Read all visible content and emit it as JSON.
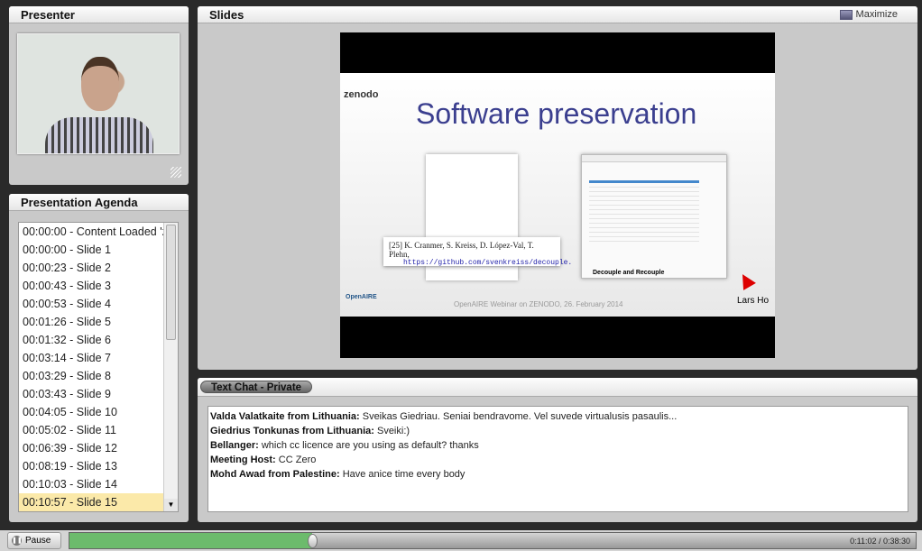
{
  "presenter": {
    "title": "Presenter"
  },
  "agenda": {
    "title": "Presentation Agenda",
    "selected_index": 15,
    "items": [
      "00:00:00 - Content Loaded 'z",
      "00:00:00 - Slide 1",
      "00:00:23 - Slide 2",
      "00:00:43 - Slide 3",
      "00:00:53 - Slide 4",
      "00:01:26 - Slide 5",
      "00:01:32 - Slide 6",
      "00:03:14 - Slide 7",
      "00:03:29 - Slide 8",
      "00:03:43 - Slide 9",
      "00:04:05 - Slide 10",
      "00:05:02 - Slide 11",
      "00:06:39 - Slide 12",
      "00:08:19 - Slide 13",
      "00:10:03 - Slide 14",
      "00:10:57 - Slide 15"
    ]
  },
  "slides": {
    "title": "Slides",
    "maximize_label": "Maximize",
    "slide": {
      "logo": "zenodo",
      "title": "Software preservation",
      "citation": "[25] K. Cranmer, S. Kreiss, D. López-Val, T. Plehn,",
      "citation_url": "https://github.com/svenkreiss/decouple.",
      "screenshot_heading": "Decouple and Recouple",
      "footer": "OpenAIRE Webinar on ZENODO, 26. February 2014",
      "openaire_logo": "OpenAIRE",
      "presenter_name": "Lars Ho"
    }
  },
  "chat": {
    "tab_label": "Text Chat - Private",
    "messages": [
      {
        "author": "Valda Valatkaite from Lithuania:",
        "text": " Sveikas Giedriau. Seniai bendravome. Vel suvede virtualusis pasaulis..."
      },
      {
        "author": "Giedrius Tonkunas from Lithuania:",
        "text": " Sveiki:)"
      },
      {
        "author": "Bellanger:",
        "text": " which cc licence are you using as default? thanks"
      },
      {
        "author": "Meeting Host:",
        "text": " CC Zero"
      },
      {
        "author": "Mohd Awad from Palestine:",
        "text": " Have anice time every body"
      }
    ]
  },
  "playback": {
    "pause_label": "Pause",
    "time": "0:11:02 / 0:38:30",
    "progress": 0.2866,
    "progress_color": "#6cbb6c"
  }
}
